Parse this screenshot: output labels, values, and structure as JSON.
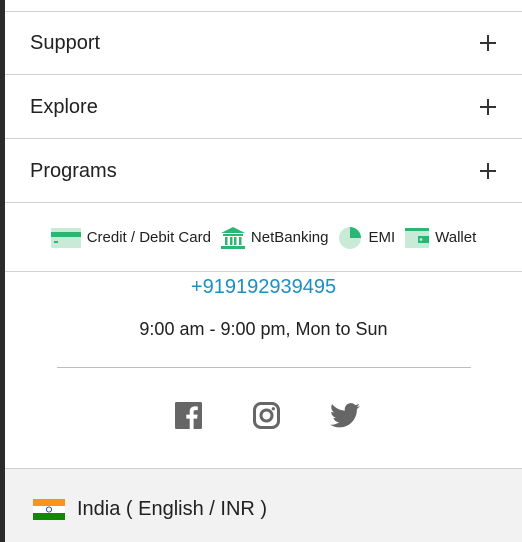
{
  "accordion": {
    "items": [
      {
        "label": "Support"
      },
      {
        "label": "Explore"
      },
      {
        "label": "Programs"
      }
    ]
  },
  "payments": {
    "items": [
      {
        "label": "Credit / Debit Card",
        "icon": "card-icon"
      },
      {
        "label": "NetBanking",
        "icon": "bank-icon"
      },
      {
        "label": "EMI",
        "icon": "emi-pie-icon"
      },
      {
        "label": "Wallet",
        "icon": "wallet-icon"
      }
    ]
  },
  "contact": {
    "phone": "+919192939495",
    "hours": "9:00 am - 9:00 pm, Mon to Sun"
  },
  "social": {
    "items": [
      "facebook-icon",
      "instagram-icon",
      "twitter-icon"
    ]
  },
  "locale": {
    "label": "India ( English / INR )",
    "flag_icon": "india-flag-icon"
  },
  "colors": {
    "accent_link": "#1a8fc4",
    "payment_green": "#2bb673",
    "icon_gray": "#666666",
    "footer_bg": "#f2f2f2"
  }
}
